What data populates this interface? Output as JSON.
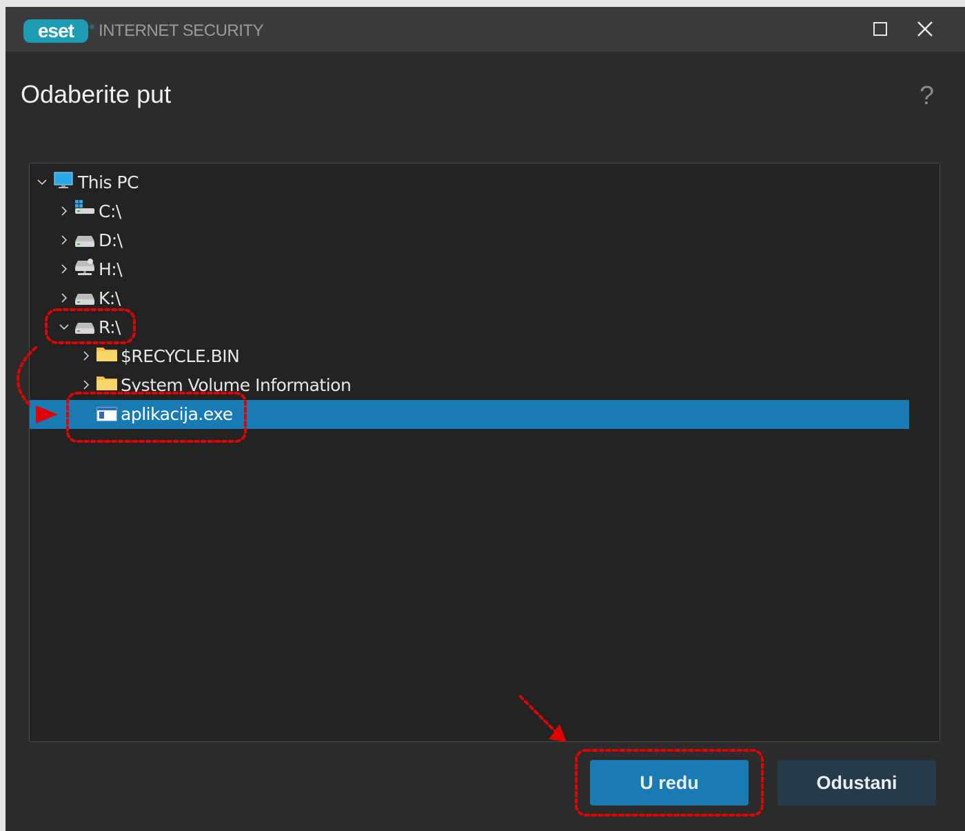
{
  "window": {
    "brand": "eset",
    "product": "INTERNET SECURITY",
    "maximize_icon": "maximize-icon",
    "close_icon": "close-icon"
  },
  "dialog": {
    "title": "Odaberite put",
    "help": "?"
  },
  "tree": {
    "items": [
      {
        "label": "This PC",
        "icon": "computer-icon",
        "expanded": true,
        "level": 0
      },
      {
        "label": "C:\\",
        "icon": "system-drive-icon",
        "expanded": false,
        "level": 1
      },
      {
        "label": "D:\\",
        "icon": "drive-icon",
        "expanded": false,
        "level": 1
      },
      {
        "label": "H:\\",
        "icon": "network-drive-icon",
        "expanded": false,
        "level": 1
      },
      {
        "label": "K:\\",
        "icon": "drive-icon",
        "expanded": false,
        "level": 1
      },
      {
        "label": "R:\\",
        "icon": "drive-icon",
        "expanded": true,
        "level": 1
      },
      {
        "label": "$RECYCLE.BIN",
        "icon": "folder-icon",
        "expanded": false,
        "level": 2
      },
      {
        "label": "System Volume Information",
        "icon": "folder-icon",
        "expanded": false,
        "level": 2
      },
      {
        "label": "aplikacija.exe",
        "icon": "exe-file-icon",
        "selected": true,
        "level": 2
      }
    ]
  },
  "buttons": {
    "ok": "U redu",
    "cancel": "Odustani"
  },
  "colors": {
    "accent": "#197ab4",
    "annotation": "#e00000"
  }
}
